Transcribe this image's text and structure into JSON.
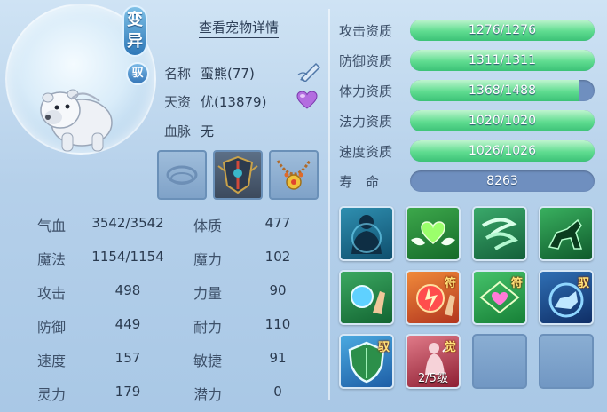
{
  "pet": {
    "variant_badge": "变异",
    "rider_badge": "驭",
    "detail_link": "查看宠物详情",
    "name_label": "名称",
    "name_value": "蛮熊(77)",
    "aptitude_label": "天资",
    "aptitude_value": "优(13879)",
    "bloodline_label": "血脉",
    "bloodline_value": "无"
  },
  "equipment": [
    {
      "name": "empty-gear-slot"
    },
    {
      "name": "armor-gear-icon"
    },
    {
      "name": "necklace-gear-icon"
    }
  ],
  "aptitudes": [
    {
      "label": "攻击资质",
      "text": "1276/1276",
      "fill": 1.0
    },
    {
      "label": "防御资质",
      "text": "1311/1311",
      "fill": 1.0
    },
    {
      "label": "体力资质",
      "text": "1368/1488",
      "fill": 0.919
    },
    {
      "label": "法力资质",
      "text": "1020/1020",
      "fill": 1.0
    },
    {
      "label": "速度资质",
      "text": "1026/1026",
      "fill": 1.0
    }
  ],
  "lifespan": {
    "label": "寿　命",
    "value": "8263"
  },
  "stats_left": [
    {
      "label": "气血",
      "value": "3542/3542"
    },
    {
      "label": "魔法",
      "value": "1154/1154"
    },
    {
      "label": "攻击",
      "value": "498"
    },
    {
      "label": "防御",
      "value": "449"
    },
    {
      "label": "速度",
      "value": "157"
    },
    {
      "label": "灵力",
      "value": "179"
    }
  ],
  "stats_right": [
    {
      "label": "体质",
      "value": "477"
    },
    {
      "label": "魔力",
      "value": "102"
    },
    {
      "label": "力量",
      "value": "90"
    },
    {
      "label": "耐力",
      "value": "110"
    },
    {
      "label": "敏捷",
      "value": "91"
    },
    {
      "label": "潜力",
      "value": "0"
    }
  ],
  "skills": {
    "tag_fu": "符",
    "tag_yu": "驭",
    "tag_jue": "觉",
    "awaken_level": "2/5级"
  },
  "colors": {
    "bar_fill": "#5fdc90",
    "bar_track": "#6f8fbf",
    "accent": "#2f78b8"
  }
}
